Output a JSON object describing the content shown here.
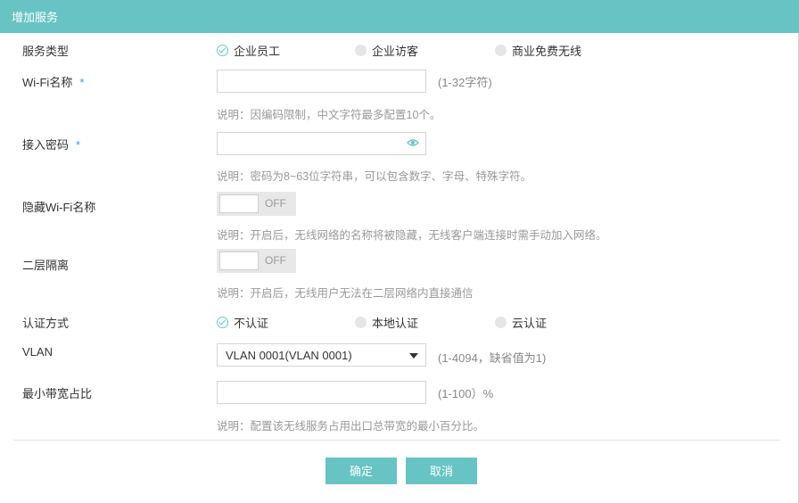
{
  "dialog": {
    "title": "增加服务"
  },
  "service_type": {
    "label": "服务类型",
    "options": [
      {
        "label": "企业员工",
        "checked": true
      },
      {
        "label": "企业访客",
        "checked": false
      },
      {
        "label": "商业免费无线",
        "checked": false
      }
    ]
  },
  "ssid": {
    "label": "Wi-Fi名称",
    "required_mark": "*",
    "value": "",
    "range_hint": "(1-32字符)",
    "note": "说明：因编码限制，中文字符最多配置10个。"
  },
  "password": {
    "label": "接入密码",
    "required_mark": "*",
    "value": "",
    "icon": "eye-icon",
    "note": "说明：密码为8~63位字符串，可以包含数字、字母、特殊字符。"
  },
  "hide_ssid": {
    "label": "隐藏Wi-Fi名称",
    "state": "OFF",
    "note": "说明：开启后，无线网络的名称将被隐藏，无线客户端连接时需手动加入网络。"
  },
  "l2_isolation": {
    "label": "二层隔离",
    "state": "OFF",
    "note": "说明：开启后，无线用户无法在二层网络内直接通信"
  },
  "auth_method": {
    "label": "认证方式",
    "options": [
      {
        "label": "不认证",
        "checked": true
      },
      {
        "label": "本地认证",
        "checked": false
      },
      {
        "label": "云认证",
        "checked": false
      }
    ]
  },
  "vlan": {
    "label": "VLAN",
    "selected": "VLAN 0001(VLAN 0001)",
    "range_hint": "(1-4094，缺省值为1)"
  },
  "min_bandwidth": {
    "label": "最小带宽占比",
    "value": "",
    "range_hint": "(1-100）%",
    "note": "说明：配置该无线服务占用出口总带宽的最小百分比。"
  },
  "footer": {
    "confirm_label": "确定",
    "cancel_label": "取消"
  },
  "colors": {
    "accent": "#68c4c4",
    "required": "#3ea0d6"
  }
}
